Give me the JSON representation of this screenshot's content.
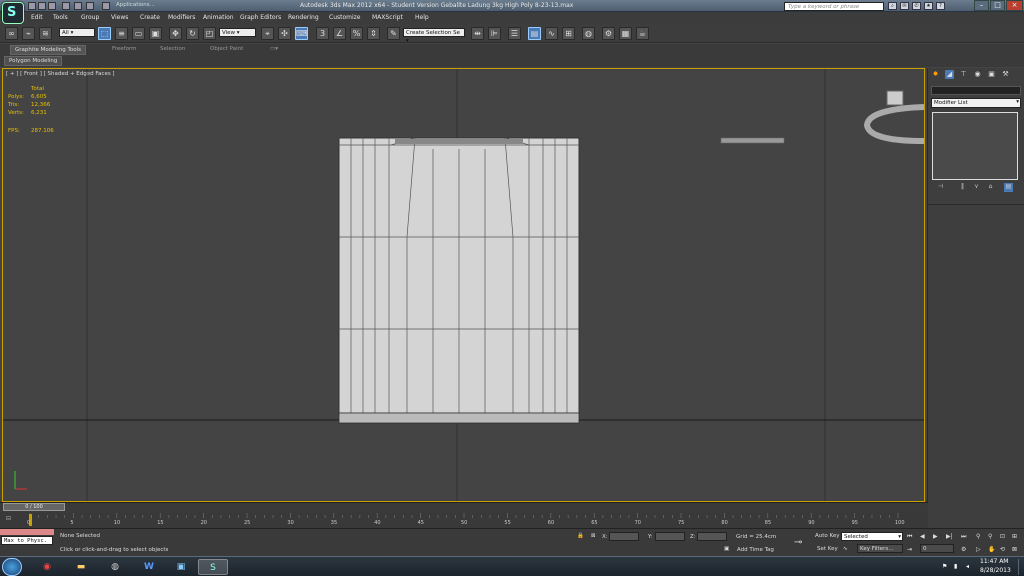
{
  "titlebar": {
    "title": "Autodesk 3ds Max  2012 x64  - Student Version    Geballte Ladung 3kg High Poly 8-23-13.max",
    "search_placeholder": "Type a keyword or phrase",
    "quick_access_text": "Applications..."
  },
  "menubar": {
    "items": [
      "Edit",
      "Tools",
      "Group",
      "Views",
      "Create",
      "Modifiers",
      "Animation",
      "Graph Editors",
      "Rendering",
      "Customize",
      "MAXScript",
      "Help"
    ]
  },
  "toolbar": {
    "filter_value": "All",
    "ref_coord_value": "View",
    "selection_set_placeholder": "Create Selection Se"
  },
  "ribbon": {
    "tabs": [
      "Graphite Modeling Tools",
      "Freeform",
      "Selection",
      "Object Paint"
    ],
    "panel_label": "Polygon Modeling"
  },
  "viewport": {
    "label": "[ + ] [ Front ] [ Shaded + Edged Faces ]",
    "stats": {
      "header": "Total",
      "polys_label": "Polys:",
      "polys_value": "6,605",
      "tris_label": "Tris:",
      "tris_value": "12,366",
      "verts_label": "Verts:",
      "verts_value": "6,231",
      "fps_label": "FPS:",
      "fps_value": "287.106"
    }
  },
  "command_panel": {
    "modifier_list": "Modifier List"
  },
  "timeline": {
    "slider_label": "0 / 100",
    "ticks": [
      "0",
      "5",
      "10",
      "15",
      "20",
      "25",
      "30",
      "35",
      "40",
      "45",
      "50",
      "55",
      "60",
      "65",
      "70",
      "75",
      "80",
      "85",
      "90",
      "95",
      "100"
    ]
  },
  "statusbar": {
    "maxscript": "Max to Physc.",
    "selection_status": "None Selected",
    "prompt": "Click or click-and-drag to select objects",
    "x_label": "X:",
    "y_label": "Y:",
    "z_label": "Z:",
    "grid": "Grid = 25.4cm",
    "add_time_tag": "Add Time Tag",
    "auto_key": "Auto Key",
    "set_key": "Set Key",
    "selected_value": "Selected",
    "key_filters": "Key Filters...",
    "frame_value": "0"
  },
  "taskbar": {
    "time": "11:47 AM",
    "date": "8/28/2013"
  },
  "colors": {
    "viewport_border": "#c8a000",
    "stats_text": "#e8c000",
    "active_tool": "#4a7bb7"
  }
}
